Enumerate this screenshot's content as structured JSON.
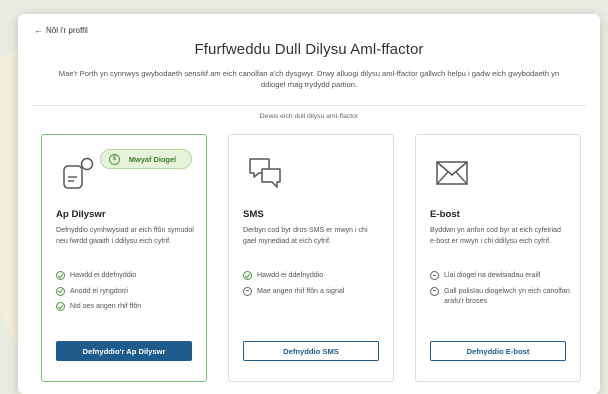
{
  "nav": {
    "back_label": "Nôl i'r proffil"
  },
  "page": {
    "title": "Ffurfweddu Dull Dilysu Aml-ffactor",
    "intro": "Mae'r Porth yn cynnwys gwybodaeth sensitif am eich canolfan a'ch dysgwyr. Drwy alluogi dilysu aml-ffactor gallwch helpu i gadw eich gwybodaeth yn ddiogel rhag trydydd partion.",
    "choose_label": "Dewis eich dull dilysu aml-ffactor"
  },
  "colors": {
    "accent": "#1f5c8e",
    "positive": "#4d9a3e",
    "selected_border": "#7fc07a"
  },
  "cards": [
    {
      "icon": "authenticator-app-icon",
      "badge": "Mwyaf Diogel",
      "title": "Ap Dilyswr",
      "description": "Defnyddio cymhwysiad ar eich ffôn symudol neu fwrdd gwaith i ddilysu eich cyfrif.",
      "features": [
        {
          "type": "check",
          "text": "Hawdd ei ddefnyddio"
        },
        {
          "type": "check",
          "text": "Anodd ei ryngdorri"
        },
        {
          "type": "check",
          "text": "Nid oes angen rhif ffôn"
        }
      ],
      "button": "Defnyddio'r Ap Dilyswr"
    },
    {
      "icon": "sms-chat-icon",
      "title": "SMS",
      "description": "Derbyn cod byr dros SMS er mwyn i chi gael mynediad at eich cyfrif.",
      "features": [
        {
          "type": "check",
          "text": "Hawdd ei ddefnyddio"
        },
        {
          "type": "minus",
          "text": "Mae angen rhif ffôn a signal"
        }
      ],
      "button": "Defnyddio SMS"
    },
    {
      "icon": "envelope-icon",
      "title": "E-bost",
      "description": "Byddwn yn anfon cod byr at eich cyfeiriad e-bost er mwyn i chi ddilysu eich cyfrif.",
      "features": [
        {
          "type": "minus",
          "text": "Llai diogel na dewisiadau eraill"
        },
        {
          "type": "minus",
          "text": "Gall polisïau diogelwch yn eich canolfan arafu'r broses"
        }
      ],
      "button": "Defnyddio E-bost"
    }
  ]
}
